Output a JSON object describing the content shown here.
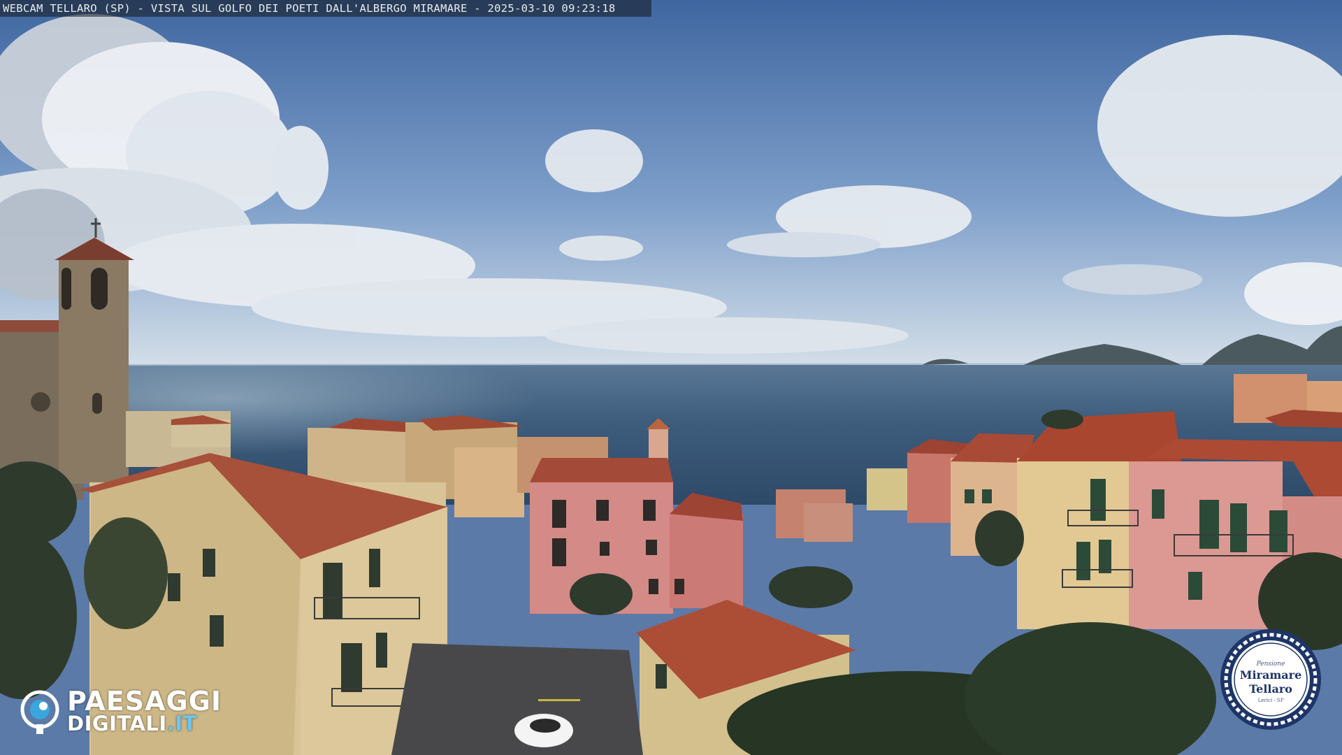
{
  "caption": {
    "text": "WEBCAM TELLARO (SP) - VISTA SUL GOLFO DEI POETI DALL'ALBERGO MIRAMARE - 2025-03-10 09:23:18"
  },
  "brand": {
    "name_line1": "PAESAGGI",
    "name_line2": "DIGITALI",
    "tld": ".IT",
    "icon": "eye-icon"
  },
  "badge": {
    "small": "Pensione",
    "line1": "Miramare",
    "line2": "Tellaro",
    "tiny": "Lerici - SP"
  },
  "colors": {
    "sky_top": "#4a6fa6",
    "sky_horizon": "#cfdbe8",
    "sea": "#3f5f80",
    "roof": "#a64a36",
    "pink_facade": "#d98a86",
    "cream_facade": "#d6c08a",
    "brand_accent": "#6cc6f0",
    "badge_navy": "#1d3568"
  }
}
